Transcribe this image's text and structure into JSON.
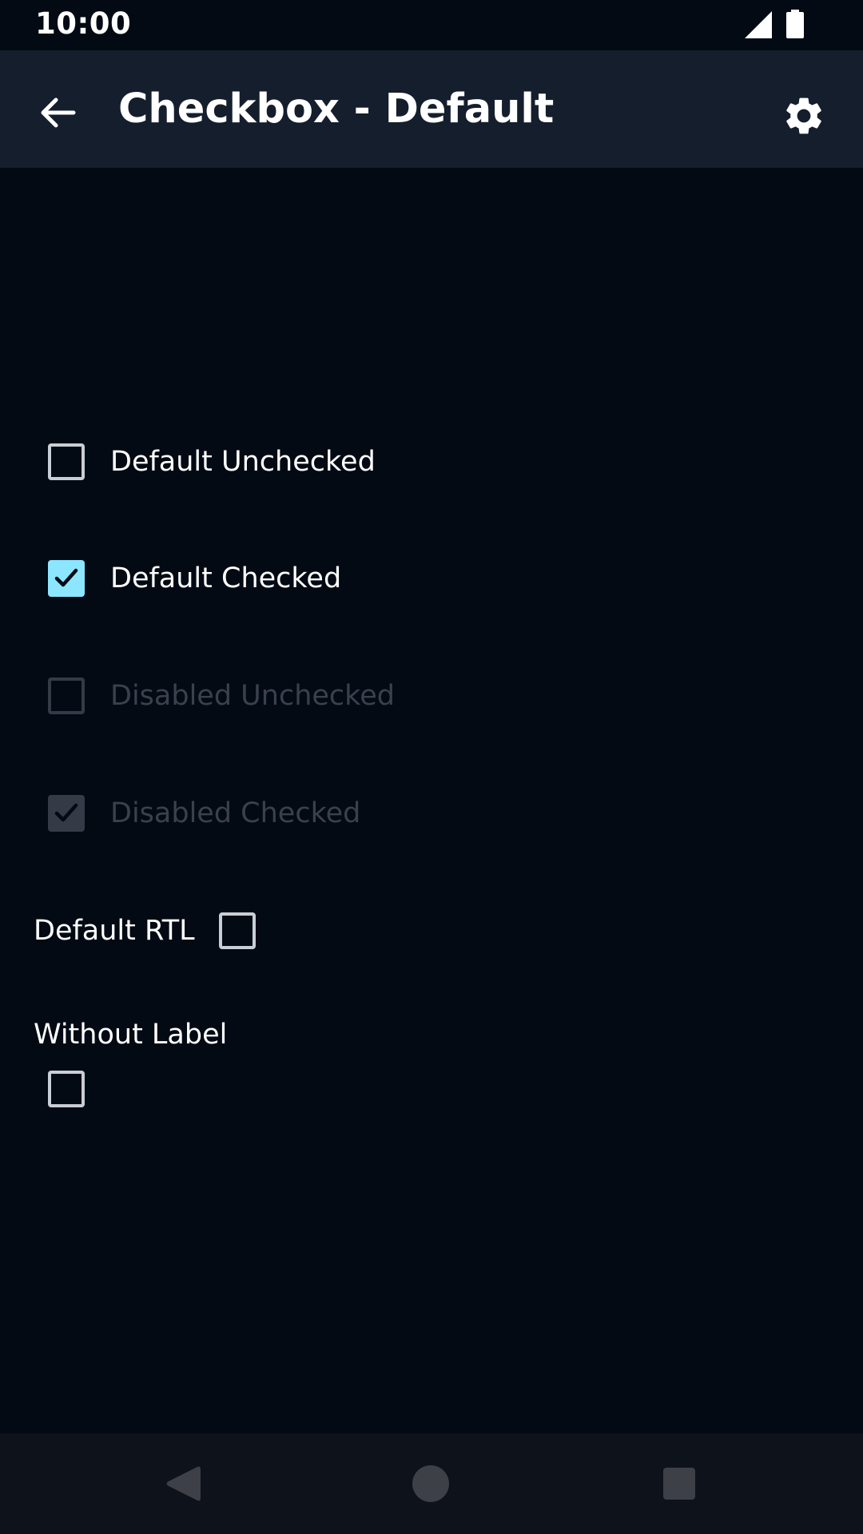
{
  "status_bar": {
    "time": "10:00"
  },
  "app_bar": {
    "title": "Checkbox - Default"
  },
  "checkboxes": [
    {
      "label": "Default Unchecked",
      "checked": false,
      "disabled": false
    },
    {
      "label": "Default Checked",
      "checked": true,
      "disabled": false
    },
    {
      "label": "Disabled Unchecked",
      "checked": false,
      "disabled": true
    },
    {
      "label": "Disabled Checked",
      "checked": true,
      "disabled": true
    }
  ],
  "rtl": {
    "label": "Default RTL",
    "checked": false
  },
  "without_label": {
    "heading": "Without Label",
    "checked": false
  },
  "colors": {
    "background": "#030a14",
    "app_bar": "#151e2d",
    "accent": "#8ce6ff",
    "disabled": "#343b47"
  },
  "icons": [
    "signal-icon",
    "battery-icon",
    "back-arrow-icon",
    "gear-icon",
    "checkmark-icon",
    "nav-back-icon",
    "nav-home-icon",
    "nav-recents-icon"
  ]
}
